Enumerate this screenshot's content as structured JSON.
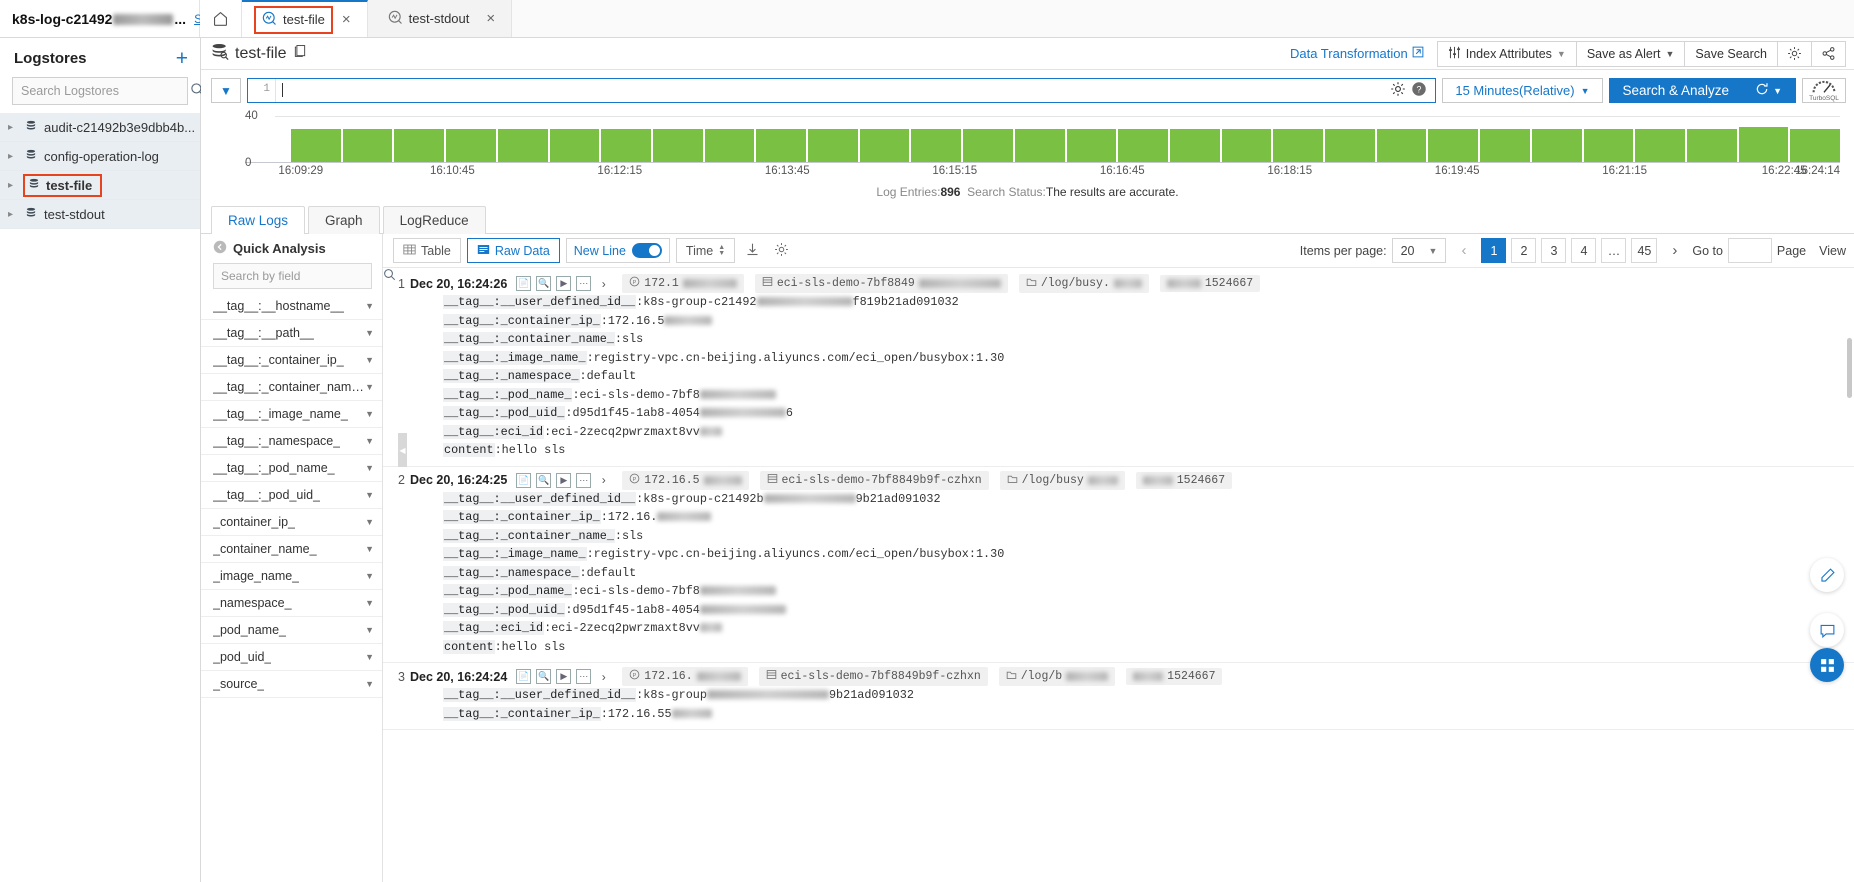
{
  "topbar": {
    "project_name": "k8s-log-c21492",
    "project_suffix": "...",
    "switch_label": "Switch",
    "home_icon": "home-icon",
    "tabs": [
      {
        "label": "test-file",
        "icon": "logstore-search-icon",
        "active": true,
        "close": "×"
      },
      {
        "label": "test-stdout",
        "icon": "logstore-search-icon",
        "active": false,
        "close": "×"
      }
    ]
  },
  "sidebar": {
    "title": "Logstores",
    "add_label": "+",
    "search_placeholder": "Search Logstores",
    "search_value": "",
    "items": [
      {
        "label": "audit-c21492b3e9dbb4b...",
        "selected": false
      },
      {
        "label": "config-operation-log",
        "selected": false
      },
      {
        "label": "test-file",
        "selected": true
      },
      {
        "label": "test-stdout",
        "selected": false
      }
    ]
  },
  "content_header": {
    "title": "test-file",
    "copy_icon": "copy-icon",
    "data_transformation": "Data Transformation",
    "external_icon": "external-link-icon",
    "index_attributes": "Index Attributes",
    "save_as_alert": "Save as Alert",
    "save_search": "Save Search",
    "settings_icon": "gear-icon",
    "share_icon": "share-icon"
  },
  "query": {
    "line_number": "1",
    "value": "",
    "settings_icon": "gear-icon",
    "help_icon": "help-icon",
    "time_range": "15 Minutes(Relative)",
    "search_button": "Search & Analyze",
    "refresh_icon": "refresh-icon",
    "turbo_label": "TurboSQL"
  },
  "chart_data": {
    "type": "bar",
    "title": "",
    "xlabel": "",
    "ylabel": "",
    "ylim": [
      0,
      40
    ],
    "yticks": [
      "0",
      "40"
    ],
    "grid": true,
    "legend": "none",
    "xtick_labels": [
      "16:09:29",
      "16:10:45",
      "16:12:15",
      "16:13:45",
      "16:15:15",
      "16:16:45",
      "16:18:15",
      "16:19:45",
      "16:21:15",
      "16:22:45",
      "16:24:14"
    ],
    "xtick_positions_pct": [
      3.5,
      13.0,
      23.5,
      34.0,
      44.5,
      55.0,
      65.5,
      76.0,
      86.5,
      96.5,
      100
    ],
    "bar_color": "#7ac143",
    "categories": [
      "16:09:29",
      "16:10:00",
      "16:10:30",
      "16:11:00",
      "16:11:30",
      "16:12:00",
      "16:12:30",
      "16:13:00",
      "16:13:30",
      "16:14:00",
      "16:14:30",
      "16:15:00",
      "16:15:30",
      "16:16:00",
      "16:16:30",
      "16:17:00",
      "16:17:30",
      "16:18:00",
      "16:18:30",
      "16:19:00",
      "16:19:30",
      "16:20:00",
      "16:20:30",
      "16:21:00",
      "16:21:30",
      "16:22:00",
      "16:22:30",
      "16:23:00",
      "16:23:30",
      "16:24:00"
    ],
    "values": [
      30,
      30,
      30,
      30,
      30,
      30,
      30,
      30,
      30,
      30,
      30,
      30,
      30,
      30,
      30,
      30,
      30,
      30,
      30,
      30,
      30,
      30,
      30,
      30,
      30,
      30,
      30,
      30,
      32,
      30
    ]
  },
  "status": {
    "entries_label": "Log Entries:",
    "entries_count": "896",
    "search_status_label": "Search Status:",
    "search_status_value": "The results are accurate."
  },
  "result_tabs": [
    {
      "label": "Raw Logs",
      "active": true
    },
    {
      "label": "Graph",
      "active": false
    },
    {
      "label": "LogReduce",
      "active": false
    }
  ],
  "quick_analysis": {
    "title": "Quick Analysis",
    "back_icon": "collapse-left-icon",
    "search_placeholder": "Search by field",
    "search_value": "",
    "fields": [
      "__tag__:__hostname__",
      "__tag__:__path__",
      "__tag__:_container_ip_",
      "__tag__:_container_name_",
      "__tag__:_image_name_",
      "__tag__:_namespace_",
      "__tag__:_pod_name_",
      "__tag__:_pod_uid_",
      "_container_ip_",
      "_container_name_",
      "_image_name_",
      "_namespace_",
      "_pod_name_",
      "_pod_uid_",
      "_source_"
    ]
  },
  "logs_toolbar": {
    "table_label": "Table",
    "raw_data_label": "Raw Data",
    "new_line_label": "New Line",
    "new_line_on": true,
    "time_label": "Time",
    "download_icon": "download-icon",
    "settings_icon": "gear-icon",
    "items_per_page_label": "Items per page:",
    "items_per_page_value": "20",
    "pages": [
      "1",
      "2",
      "3",
      "4",
      "…",
      "45"
    ],
    "active_page": "1",
    "goto_label": "Go to",
    "goto_value": "",
    "page_label": "Page",
    "view_label": "View"
  },
  "log_entries": [
    {
      "index": "1",
      "time": "Dec 20, 16:24:26",
      "chips": [
        {
          "icon": "ip-icon",
          "text": "172.1",
          "blur_w": 54
        },
        {
          "icon": "pod-icon",
          "text": "eci-sls-demo-7bf8849",
          "blur_w": 82
        },
        {
          "icon": "path-icon",
          "text": "/log/busy.",
          "blur_w": 28
        },
        {
          "icon": "none",
          "text": "1524667",
          "blur_w": 34,
          "blur_first": true
        }
      ],
      "fields": [
        {
          "k": "__tag__:__user_defined_id__",
          "v": ":k8s-group-c21492",
          "blur_w": 96,
          "v2": "f819b21ad091032"
        },
        {
          "k": "__tag__:_container_ip_",
          "v": ":172.16.5",
          "blur_w": 48,
          "v2": ""
        },
        {
          "k": "__tag__:_container_name_",
          "v": ":sls",
          "blur_w": 0,
          "v2": ""
        },
        {
          "k": "__tag__:_image_name_",
          "v": ":registry-vpc.cn-beijing.aliyuncs.com/eci_open/busybox:1.30",
          "blur_w": 0,
          "v2": ""
        },
        {
          "k": "__tag__:_namespace_",
          "v": ":default",
          "blur_w": 0,
          "v2": ""
        },
        {
          "k": "__tag__:_pod_name_",
          "v": ":eci-sls-demo-7bf8",
          "blur_w": 76,
          "v2": ""
        },
        {
          "k": "__tag__:_pod_uid_",
          "v": ":d95d1f45-1ab8-4054",
          "blur_w": 86,
          "v2": "6"
        },
        {
          "k": "__tag__:eci_id",
          "v": ":eci-2zecq2pwrzmaxt8vv",
          "blur_w": 22,
          "v2": ""
        },
        {
          "k": "content",
          "v": ":hello sls",
          "blur_w": 0,
          "v2": ""
        }
      ]
    },
    {
      "index": "2",
      "time": "Dec 20, 16:24:25",
      "chips": [
        {
          "icon": "ip-icon",
          "text": "172.16.5",
          "blur_w": 38
        },
        {
          "icon": "pod-icon",
          "text": "eci-sls-demo-7bf8849b9f-czhxn",
          "blur_w": 0
        },
        {
          "icon": "path-icon",
          "text": "/log/busy",
          "blur_w": 30
        },
        {
          "icon": "none",
          "text": "1524667",
          "blur_w": 30,
          "blur_first": true
        }
      ],
      "fields": [
        {
          "k": "__tag__:__user_defined_id__",
          "v": ":k8s-group-c21492b",
          "blur_w": 92,
          "v2": "9b21ad091032"
        },
        {
          "k": "__tag__:_container_ip_",
          "v": ":172.16.",
          "blur_w": 54,
          "v2": ""
        },
        {
          "k": "__tag__:_container_name_",
          "v": ":sls",
          "blur_w": 0,
          "v2": ""
        },
        {
          "k": "__tag__:_image_name_",
          "v": ":registry-vpc.cn-beijing.aliyuncs.com/eci_open/busybox:1.30",
          "blur_w": 0,
          "v2": ""
        },
        {
          "k": "__tag__:_namespace_",
          "v": ":default",
          "blur_w": 0,
          "v2": ""
        },
        {
          "k": "__tag__:_pod_name_",
          "v": ":eci-sls-demo-7bf8",
          "blur_w": 76,
          "v2": ""
        },
        {
          "k": "__tag__:_pod_uid_",
          "v": ":d95d1f45-1ab8-4054",
          "blur_w": 86,
          "v2": ""
        },
        {
          "k": "__tag__:eci_id",
          "v": ":eci-2zecq2pwrzmaxt8vv",
          "blur_w": 22,
          "v2": ""
        },
        {
          "k": "content",
          "v": ":hello sls",
          "blur_w": 0,
          "v2": ""
        }
      ]
    },
    {
      "index": "3",
      "time": "Dec 20, 16:24:24",
      "chips": [
        {
          "icon": "ip-icon",
          "text": "172.16.",
          "blur_w": 44
        },
        {
          "icon": "pod-icon",
          "text": "eci-sls-demo-7bf8849b9f-czhxn",
          "blur_w": 0
        },
        {
          "icon": "path-icon",
          "text": "/log/b",
          "blur_w": 42
        },
        {
          "icon": "none",
          "text": "1524667",
          "blur_w": 30,
          "blur_first": true
        }
      ],
      "fields": [
        {
          "k": "__tag__:__user_defined_id__",
          "v": ":k8s-group",
          "blur_w": 122,
          "v2": "9b21ad091032"
        },
        {
          "k": "__tag__:_container_ip_",
          "v": ":172.16.55",
          "blur_w": 40,
          "v2": ""
        }
      ]
    }
  ],
  "fabs": [
    {
      "icon": "edit-icon"
    },
    {
      "icon": "feedback-icon"
    },
    {
      "icon": "apps-icon"
    }
  ],
  "colors": {
    "accent": "#1677c9",
    "bar_green": "#7ac143",
    "highlight_red": "#e8431f"
  }
}
